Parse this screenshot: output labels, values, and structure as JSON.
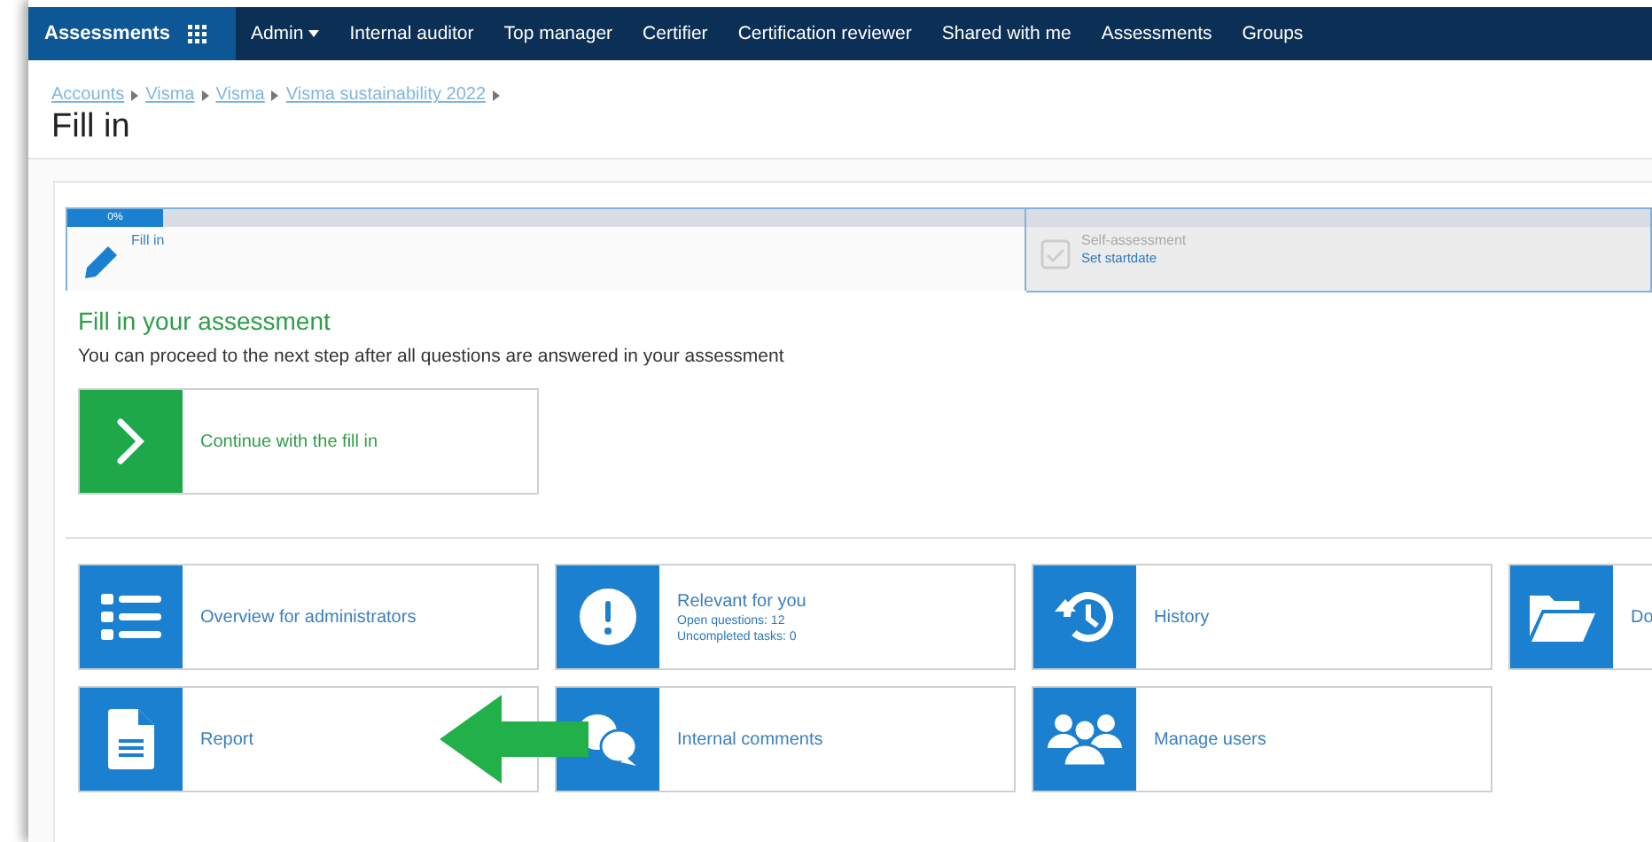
{
  "navbar": {
    "brand": "Assessments",
    "items": [
      {
        "label": "Admin",
        "dropdown": true
      },
      {
        "label": "Internal auditor",
        "dropdown": false
      },
      {
        "label": "Top manager",
        "dropdown": false
      },
      {
        "label": "Certifier",
        "dropdown": false
      },
      {
        "label": "Certification reviewer",
        "dropdown": false
      },
      {
        "label": "Shared with me",
        "dropdown": false
      },
      {
        "label": "Assessments",
        "dropdown": false
      },
      {
        "label": "Groups",
        "dropdown": false
      }
    ]
  },
  "breadcrumbs": [
    "Accounts",
    "Visma",
    "Visma",
    "Visma sustainability 2022"
  ],
  "page_title": "Fill in",
  "steps": [
    {
      "title": "Fill in",
      "selected": true,
      "progress": {
        "label": "0%"
      }
    },
    {
      "title": "Self-assessment",
      "subtitle": "Set startdate",
      "selected": false
    }
  ],
  "section": {
    "heading": "Fill in your assessment",
    "description": "You can proceed to the next step after all questions are answered in your assessment",
    "action": "Continue with the fill in"
  },
  "tiles": [
    {
      "label": "Overview for administrators"
    },
    {
      "label": "Relevant for you",
      "details": [
        "Open questions: 12",
        "Uncompleted tasks: 0"
      ]
    },
    {
      "label": "History"
    },
    {
      "label": "Do"
    },
    {
      "label": "Report"
    },
    {
      "label": "Internal comments"
    },
    {
      "label": "Manage users"
    }
  ]
}
